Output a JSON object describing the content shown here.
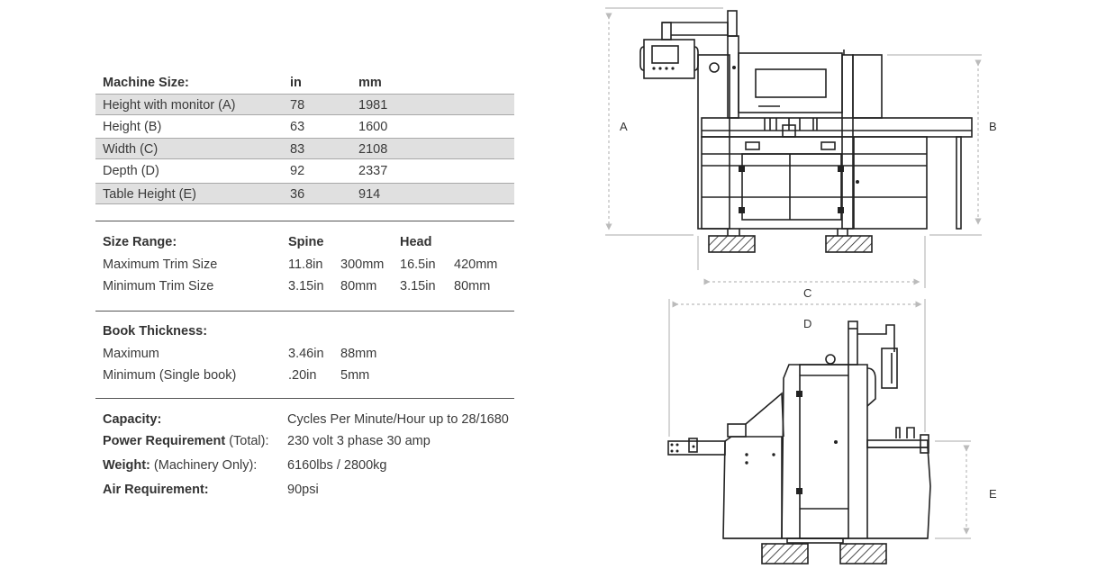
{
  "machine_size": {
    "title": "Machine Size:",
    "col_in": "in",
    "col_mm": "mm",
    "rows": [
      {
        "label": "Height with monitor (A)",
        "in": "78",
        "mm": "1981"
      },
      {
        "label": "Height (B)",
        "in": "63",
        "mm": "1600"
      },
      {
        "label": "Width (C)",
        "in": "83",
        "mm": "2108"
      },
      {
        "label": "Depth (D)",
        "in": "92",
        "mm": "2337"
      },
      {
        "label": "Table Height (E)",
        "in": "36",
        "mm": "914"
      }
    ]
  },
  "size_range": {
    "title": "Size Range:",
    "col_spine": "Spine",
    "col_head": "Head",
    "rows": [
      {
        "label": "Maximum Trim Size",
        "spine_in": "11.8in",
        "spine_mm": "300mm",
        "head_in": "16.5in",
        "head_mm": "420mm"
      },
      {
        "label": "Minimum Trim Size",
        "spine_in": "3.15in",
        "spine_mm": "80mm",
        "head_in": "3.15in",
        "head_mm": "80mm"
      }
    ]
  },
  "book_thickness": {
    "title": "Book Thickness:",
    "rows": [
      {
        "label": "Maximum",
        "in": "3.46in",
        "mm": "88mm"
      },
      {
        "label": "Minimum (Single book)",
        "in": ".20in",
        "mm": "5mm"
      }
    ]
  },
  "general": {
    "rows": [
      {
        "label_bold": "Capacity:",
        "label_rest": "",
        "value": "Cycles Per Minute/Hour up to 28/1680"
      },
      {
        "label_bold": "Power Requirement",
        "label_rest": " (Total):",
        "value": "230 volt 3 phase  30 amp"
      },
      {
        "label_bold": "Weight:",
        "label_rest": " (Machinery Only):",
        "value": "6160lbs / 2800kg"
      },
      {
        "label_bold": "Air Requirement:",
        "label_rest": "",
        "value": "90psi"
      }
    ]
  },
  "diagram": {
    "front_labels": {
      "a": "A",
      "b": "B",
      "c": "C"
    },
    "side_labels": {
      "d": "D",
      "e": "E"
    }
  }
}
